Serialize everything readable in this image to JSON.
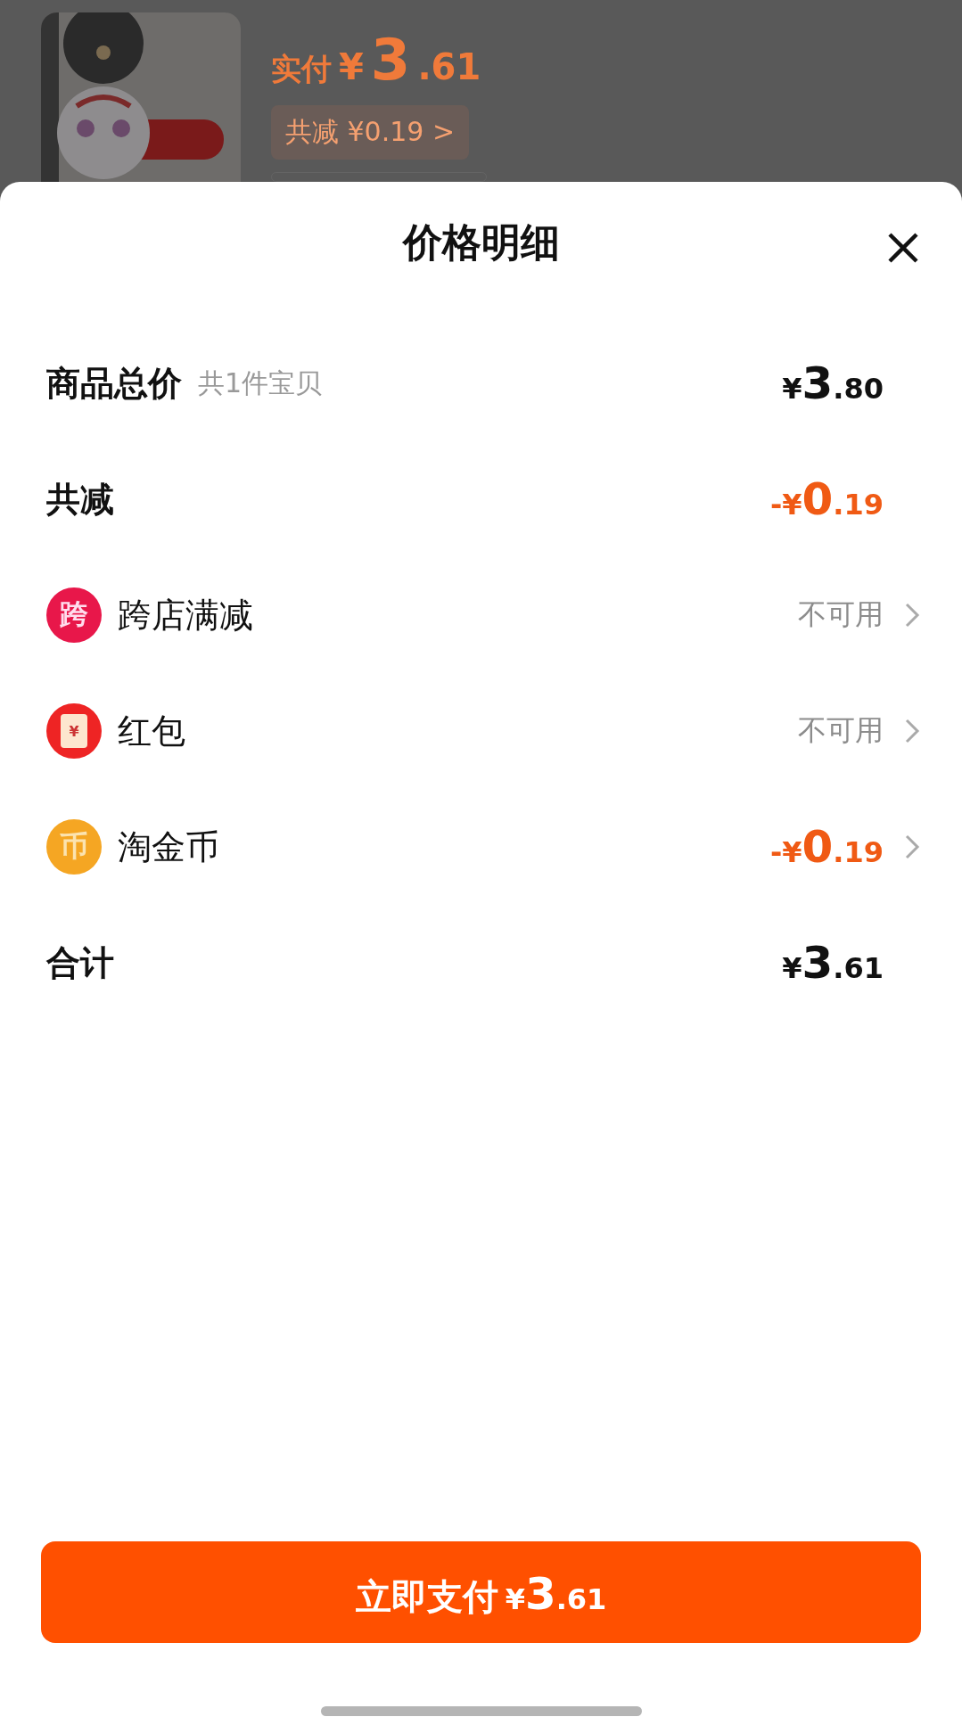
{
  "order": {
    "paid_label": "实付",
    "paid_price": {
      "symbol": "¥",
      "whole": "3",
      "fraction": ".61"
    },
    "discount_pill": "共减 ¥0.19 >"
  },
  "sheet": {
    "title": "价格明细",
    "rows": [
      {
        "kind": "plain",
        "label": "商品总价",
        "note": "共1件宝贝",
        "price": {
          "symbol": "¥",
          "whole": "3",
          "fraction": ".80"
        },
        "highlight": false,
        "chevron": false
      },
      {
        "kind": "plain",
        "label": "共减",
        "price": {
          "sign": "-",
          "symbol": "¥",
          "whole": "0",
          "fraction": ".19"
        },
        "highlight": true,
        "chevron": false
      },
      {
        "kind": "badge",
        "badge": "跨",
        "color": "#e8174a",
        "label": "跨店满减",
        "status": "不可用",
        "chevron": true
      },
      {
        "kind": "packet",
        "badge": "¥",
        "color": "#ee2424",
        "label": "红包",
        "status": "不可用",
        "chevron": true
      },
      {
        "kind": "coin",
        "badge": "币",
        "color": "#f5a623",
        "label": "淘金币",
        "price": {
          "sign": "-",
          "symbol": "¥",
          "whole": "0",
          "fraction": ".19"
        },
        "highlight": true,
        "chevron": true
      },
      {
        "kind": "plain",
        "label": "合计",
        "price": {
          "symbol": "¥",
          "whole": "3",
          "fraction": ".61"
        },
        "highlight": false,
        "chevron": false
      }
    ],
    "pay_button": {
      "label": "立即支付",
      "price": {
        "symbol": "¥",
        "whole": "3",
        "fraction": ".61"
      }
    }
  }
}
